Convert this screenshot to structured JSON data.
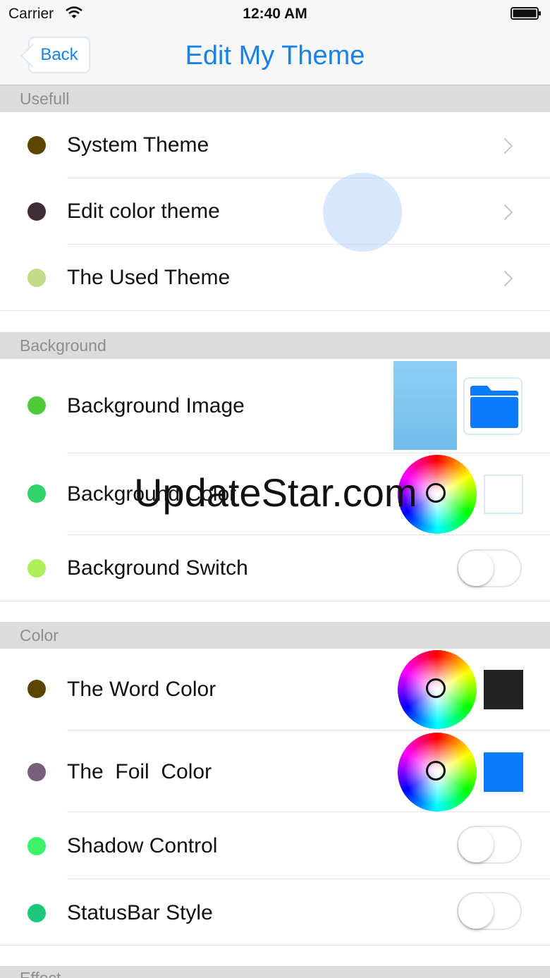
{
  "status_bar": {
    "carrier": "Carrier",
    "time": "12:40 AM"
  },
  "nav": {
    "back_label": "Back",
    "title": "Edit My Theme"
  },
  "sections": {
    "usefull": {
      "header": "Usefull",
      "rows": [
        {
          "label": "System Theme",
          "dot_color": "#5c4500",
          "accessory": "chevron-right-icon"
        },
        {
          "label": "Edit color theme",
          "dot_color": "#3d2e36",
          "accessory": "chevron-right-icon"
        },
        {
          "label": "The Used Theme",
          "dot_color": "#c3d985",
          "accessory": "chevron-right-icon"
        }
      ]
    },
    "background": {
      "header": "Background",
      "rows": [
        {
          "label": "Background Image",
          "dot_color": "#4fcb3a",
          "accessory": "folder-icon"
        },
        {
          "label": "Background Color",
          "dot_color": "#2fd46a",
          "accessory": "color-wheel",
          "swatch_color": "#ffffff"
        },
        {
          "label": "Background Switch",
          "dot_color": "#aef05a",
          "accessory": "toggle",
          "toggle_on": false
        }
      ]
    },
    "color": {
      "header": "Color",
      "rows": [
        {
          "label": "The Word Color",
          "dot_color": "#5c4500",
          "accessory": "color-wheel",
          "swatch_color": "#222222"
        },
        {
          "label": "The  Foil  Color",
          "dot_color": "#7a5f7a",
          "accessory": "color-wheel",
          "swatch_color": "#0a7bff"
        },
        {
          "label": "Shadow Control",
          "dot_color": "#3ef06a",
          "accessory": "toggle",
          "toggle_on": false
        },
        {
          "label": "StatusBar Style",
          "dot_color": "#1ec87a",
          "accessory": "toggle",
          "toggle_on": false
        }
      ]
    },
    "effect": {
      "header": "Effect"
    }
  },
  "watermark": "UpdateStar.com",
  "colors": {
    "accent": "#1a82e6",
    "section_bg": "#dcdcdc"
  }
}
